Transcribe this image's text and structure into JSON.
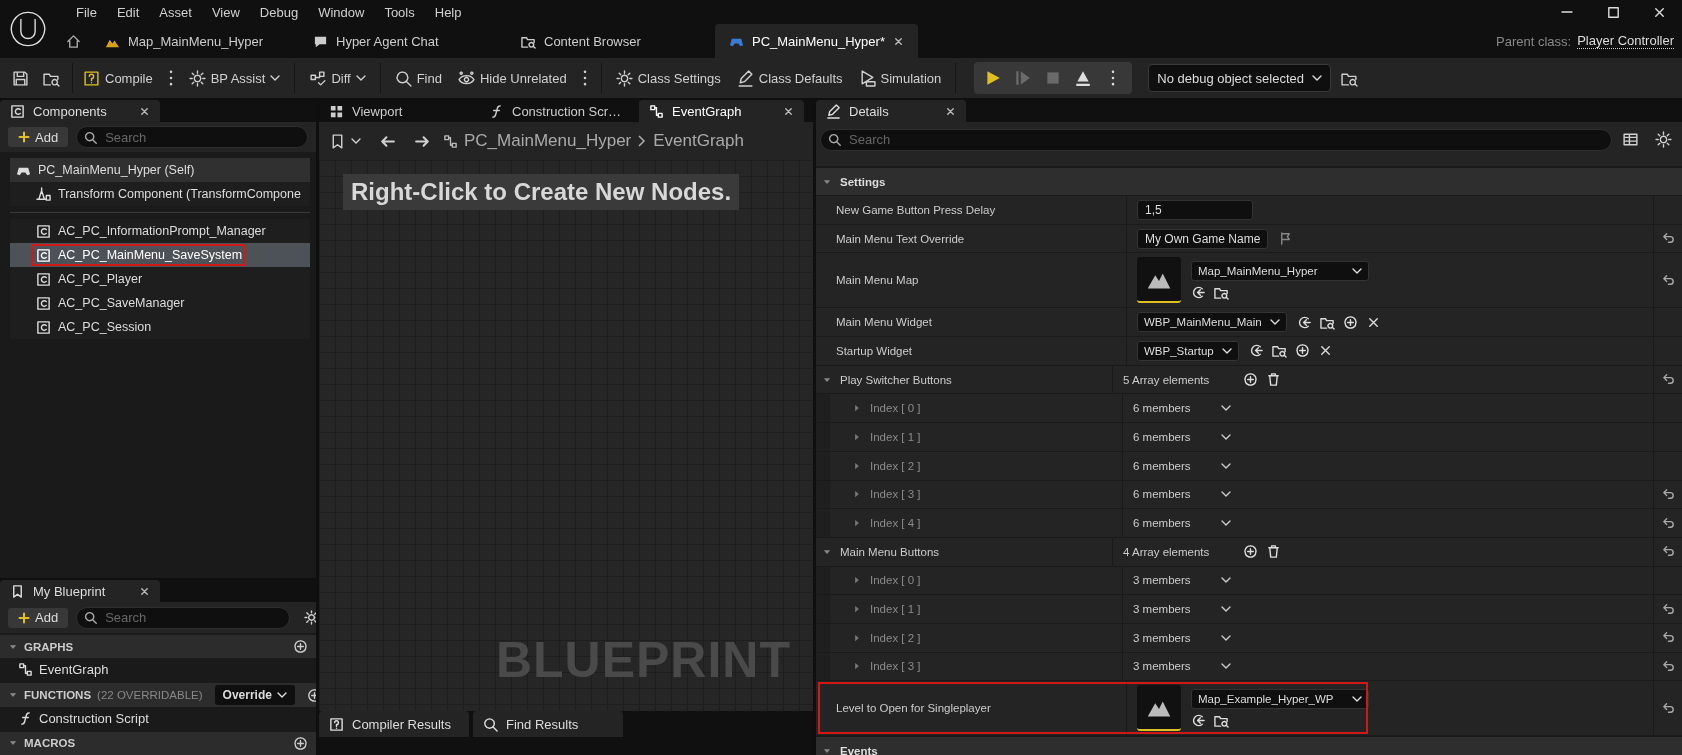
{
  "menu": [
    "File",
    "Edit",
    "Asset",
    "View",
    "Debug",
    "Window",
    "Tools",
    "Help"
  ],
  "doc_tabs": [
    {
      "label": "Map_MainMenu_Hyper",
      "selected": false
    },
    {
      "label": "Hyper Agent Chat",
      "selected": false
    },
    {
      "label": "Content Browser",
      "selected": false
    },
    {
      "label": "PC_MainMenu_Hyper*",
      "selected": true
    }
  ],
  "parent_class": {
    "label": "Parent class:",
    "value": "Player Controller"
  },
  "toolbar": [
    {
      "label": "Compile",
      "menu": false
    },
    {
      "label": "BP Assist",
      "menu": true
    },
    {
      "label": "Diff",
      "menu": true
    },
    {
      "label": "Find",
      "menu": false
    },
    {
      "label": "Hide Unrelated",
      "menu": false
    },
    {
      "label": "Class Settings",
      "menu": false
    },
    {
      "label": "Class Defaults",
      "menu": false
    },
    {
      "label": "Simulation",
      "menu": false
    }
  ],
  "play_controls": [
    {
      "disabled": false
    },
    {
      "disabled": true
    },
    {
      "disabled": true
    },
    {
      "disabled": false
    }
  ],
  "debug_select": "No debug object selected",
  "components": {
    "title": "Components",
    "add": "Add",
    "search_placeholder": "Search",
    "root": {
      "label": "PC_MainMenu_Hyper (Self)",
      "children": [
        {
          "label": "Transform Component (TransformCompone",
          "kind": "transform",
          "selected": false
        }
      ]
    },
    "items": [
      {
        "label": "AC_PC_InformationPrompt_Manager",
        "kind": "component",
        "selected": false,
        "highlighted": false
      },
      {
        "label": "AC_PC_MainMenu_SaveSystem",
        "kind": "component",
        "selected": true,
        "highlighted": true
      },
      {
        "label": "AC_PC_Player",
        "kind": "component",
        "selected": false,
        "highlighted": false
      },
      {
        "label": "AC_PC_SaveManager",
        "kind": "component",
        "selected": false,
        "highlighted": false
      },
      {
        "label": "AC_PC_Session",
        "kind": "component",
        "selected": false,
        "highlighted": false
      }
    ]
  },
  "my_blueprint": {
    "title": "My Blueprint",
    "add": "Add",
    "search_placeholder": "Search",
    "sections": [
      {
        "label": "GRAPHS",
        "expanded": true,
        "items": [
          {
            "label": "EventGraph",
            "kind": "graph"
          }
        ]
      },
      {
        "label": "FUNCTIONS",
        "note": "(22 OVERRIDABLE)",
        "action": "Override",
        "expanded": true,
        "items": [
          {
            "label": "Construction Script",
            "kind": "function"
          }
        ]
      },
      {
        "label": "MACROS",
        "expanded": true
      }
    ]
  },
  "graph_tabs": [
    {
      "label": "Viewport",
      "selected": false
    },
    {
      "label": "Construction Scr…",
      "selected": false
    },
    {
      "label": "EventGraph",
      "selected": true
    }
  ],
  "breadcrumb": [
    "PC_MainMenu_Hyper",
    "EventGraph"
  ],
  "graph_hint": "Right-Click to Create New Nodes.",
  "graph_watermark": "BLUEPRINT",
  "bottom_tabs": [
    "Compiler Results",
    "Find Results"
  ],
  "details": {
    "title": "Details",
    "search_placeholder": "Search",
    "categories": [
      {
        "label": "Settings",
        "expanded": true,
        "rows": [
          {
            "kind": "number",
            "label": "New Game Button Press Delay",
            "value": "1,5",
            "resettable": false
          },
          {
            "kind": "text",
            "label": "Main Menu Text Override",
            "value": "My Own Game Name",
            "resettable": true
          },
          {
            "kind": "asset",
            "label": "Main Menu Map",
            "value": "Map_MainMenu_Hyper",
            "resettable": true,
            "highlighted": false
          },
          {
            "kind": "class",
            "label": "Main Menu Widget",
            "value": "WBP_MainMenu_Main",
            "resettable": false
          },
          {
            "kind": "class",
            "label": "Startup Widget",
            "value": "WBP_Startup",
            "resettable": false
          },
          {
            "kind": "array",
            "label": "Play Switcher Buttons",
            "value": "5 Array elements",
            "expanded": true,
            "resettable": true,
            "children": [
              {
                "label": "Index [ 0 ]",
                "value": "6 members",
                "expanded": false,
                "resettable": false
              },
              {
                "label": "Index [ 1 ]",
                "value": "6 members",
                "expanded": false,
                "resettable": false
              },
              {
                "label": "Index [ 2 ]",
                "value": "6 members",
                "expanded": false,
                "resettable": false
              },
              {
                "label": "Index [ 3 ]",
                "value": "6 members",
                "expanded": false,
                "resettable": true
              },
              {
                "label": "Index [ 4 ]",
                "value": "6 members",
                "expanded": false,
                "resettable": true
              }
            ]
          },
          {
            "kind": "array",
            "label": "Main Menu Buttons",
            "value": "4 Array elements",
            "expanded": true,
            "resettable": true,
            "children": [
              {
                "label": "Index [ 0 ]",
                "value": "3 members",
                "expanded": false,
                "resettable": false
              },
              {
                "label": "Index [ 1 ]",
                "value": "3 members",
                "expanded": false,
                "resettable": true
              },
              {
                "label": "Index [ 2 ]",
                "value": "3 members",
                "expanded": false,
                "resettable": true
              },
              {
                "label": "Index [ 3 ]",
                "value": "3 members",
                "expanded": false,
                "resettable": true
              }
            ]
          },
          {
            "kind": "asset",
            "label": "Level to Open for Singleplayer",
            "value": "Map_Example_Hyper_WP",
            "resettable": true,
            "highlighted": true
          }
        ]
      },
      {
        "label": "Events",
        "expanded": true
      }
    ]
  }
}
